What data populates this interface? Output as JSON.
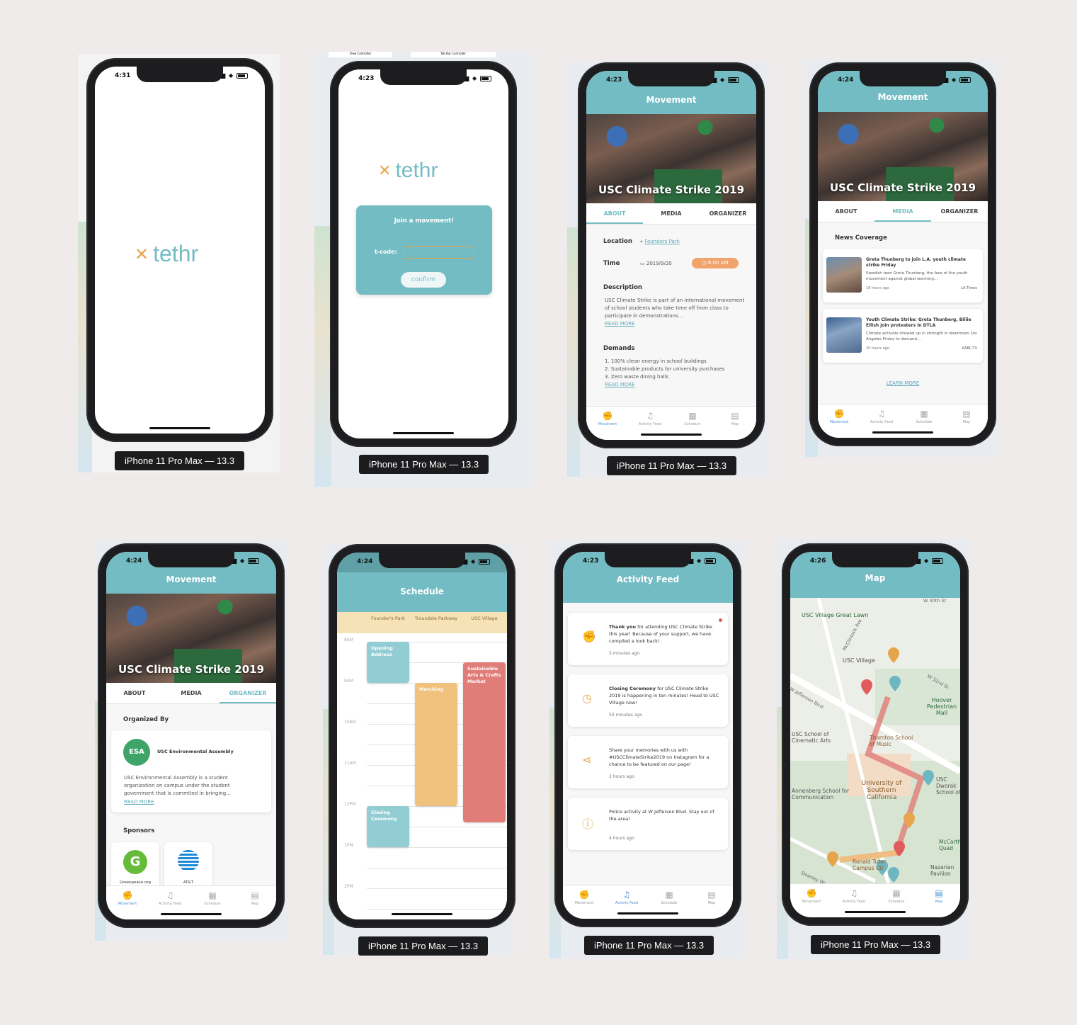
{
  "device_caption": "iPhone 11 Pro Max — 13.3",
  "tabbar": [
    "Movement",
    "Activity Feed",
    "Schedule",
    "Map"
  ],
  "tabbar_icons": [
    "raised-fist-icon",
    "bell-icon",
    "calendar-icon",
    "map-icon"
  ],
  "colors": {
    "teal": "#74bcc3",
    "orange": "#e6a54b",
    "red": "#e07d78",
    "blue": "#4a90d9"
  },
  "screens": {
    "splash": {
      "time": "4:31",
      "logo": "tethr"
    },
    "join": {
      "time": "4:23",
      "logo": "tethr",
      "bg_labels": [
        "View Controller",
        "Tab Bar Controller"
      ],
      "card_title": "Join a movement!",
      "field_label": "t-code:",
      "field_value": "",
      "button": "confirm"
    },
    "about": {
      "time": "4:23",
      "header": "Movement",
      "hero_title": "USC Climate Strike 2019",
      "tabs": [
        "ABOUT",
        "MEDIA",
        "ORGANIZER"
      ],
      "location_label": "Location",
      "location_value": "Founders Park",
      "time_label": "Time",
      "date": "2019/9/20",
      "start": "8:00 AM",
      "desc_label": "Description",
      "desc": "USC Climate Strike is part of an international movement of school students who take time off from class to participate in demonstrations...",
      "read_more": "READ MORE",
      "demands_label": "Demands",
      "demands": [
        "1. 100% clean energy in school buildings",
        "2. Sustainable products for university purchases",
        "3. Zero waste dining halls"
      ]
    },
    "media": {
      "time": "4:24",
      "header": "Movement",
      "hero_title": "USC Climate Strike 2019",
      "tabs": [
        "ABOUT",
        "MEDIA",
        "ORGANIZER"
      ],
      "section": "News Coverage",
      "articles": [
        {
          "title": "Greta Thunberg to join L.A. youth climate strike Friday",
          "body": "Swedish teen Greta Thunberg, the face of the youth movement against global warming...",
          "age": "18 hours ago",
          "source": "LA Times"
        },
        {
          "title": "Youth Climate Strike: Greta Thunberg, Billie Eilish join protesters in DTLA",
          "body": "Climate activists showed up in strength in downtown Los Angeles Friday to demand...",
          "age": "20 hours ago",
          "source": "KABC-TV"
        }
      ],
      "learn_more": "LEARN MORE"
    },
    "organizer": {
      "time": "4:24",
      "header": "Movement",
      "hero_title": "USC Climate Strike 2019",
      "tabs": [
        "ABOUT",
        "MEDIA",
        "ORGANIZER"
      ],
      "section": "Organized By",
      "org_badge": "ESA",
      "org_name": "USC Environmental Assembly",
      "org_desc": "USC Environmental Assembly is a student organization on campus under the student government that is commited in bringing...",
      "read_more": "READ MORE",
      "sponsors_label": "Sponsors",
      "sponsors": [
        "Greenpeace.org",
        "AT&T"
      ]
    },
    "schedule": {
      "time": "4:24",
      "header": "Schedule",
      "columns": [
        "Founder's Park",
        "Trousdale Parkway",
        "USC Village"
      ],
      "hours": [
        "8AM",
        "9AM",
        "10AM",
        "11AM",
        "12PM",
        "1PM",
        "2PM"
      ],
      "events": [
        {
          "name": "Opening Address",
          "col": 0,
          "start": 8.0,
          "end": 9.0,
          "color": "#93cdd4"
        },
        {
          "name": "Marching",
          "col": 1,
          "start": 9.0,
          "end": 12.0,
          "color": "#f1c27d"
        },
        {
          "name": "Sustainable Arts & Crafts Market",
          "col": 2,
          "start": 8.5,
          "end": 12.4,
          "color": "#e07d78"
        },
        {
          "name": "Closing Ceremony",
          "col": 0,
          "start": 12.0,
          "end": 13.0,
          "color": "#93cdd4"
        }
      ]
    },
    "feed": {
      "time": "4:23",
      "header": "Activity Feed",
      "items": [
        {
          "icon": "raised-fist-icon",
          "bold": "Thank you",
          "text": " for attending USC Climate Strike this year! Because of your support, we have compiled a look back!",
          "age": "5 minutes ago",
          "unread": true
        },
        {
          "icon": "clock-icon",
          "bold": "Closing Ceremony",
          "text": " for USC Climate Strike 2019 is happening in ten minutes! Head to USC Village now!",
          "age": "50 minutes ago",
          "unread": false
        },
        {
          "icon": "share-icon",
          "bold": "",
          "text": "Share your memories with us with #USCClimateStrike2019 on Instagram for a chance to be featured on our page!",
          "age": "2 hours ago",
          "unread": false
        },
        {
          "icon": "alert-icon",
          "bold": "",
          "text": "Police activity at W Jefferson Blvd. Stay out of the area!",
          "age": "4 hours ago",
          "unread": false
        }
      ]
    },
    "map": {
      "time": "4:26",
      "header": "Map",
      "labels": [
        "USC Village Great Lawn",
        "USC Village",
        "Hoover Pedestrian Mall",
        "USC School of Cinematic Arts",
        "Thornton School of Music",
        "University of Southern California",
        "Annenberg School for Communication",
        "USC Dworak School of",
        "McCarthy Quad",
        "Ronald Tutor Campus Ctr",
        "Nazarian Pavilion",
        "W Jefferson Blvd",
        "W 30th St",
        "McClintock Ave",
        "Downey Way",
        "W 32nd St"
      ]
    }
  }
}
